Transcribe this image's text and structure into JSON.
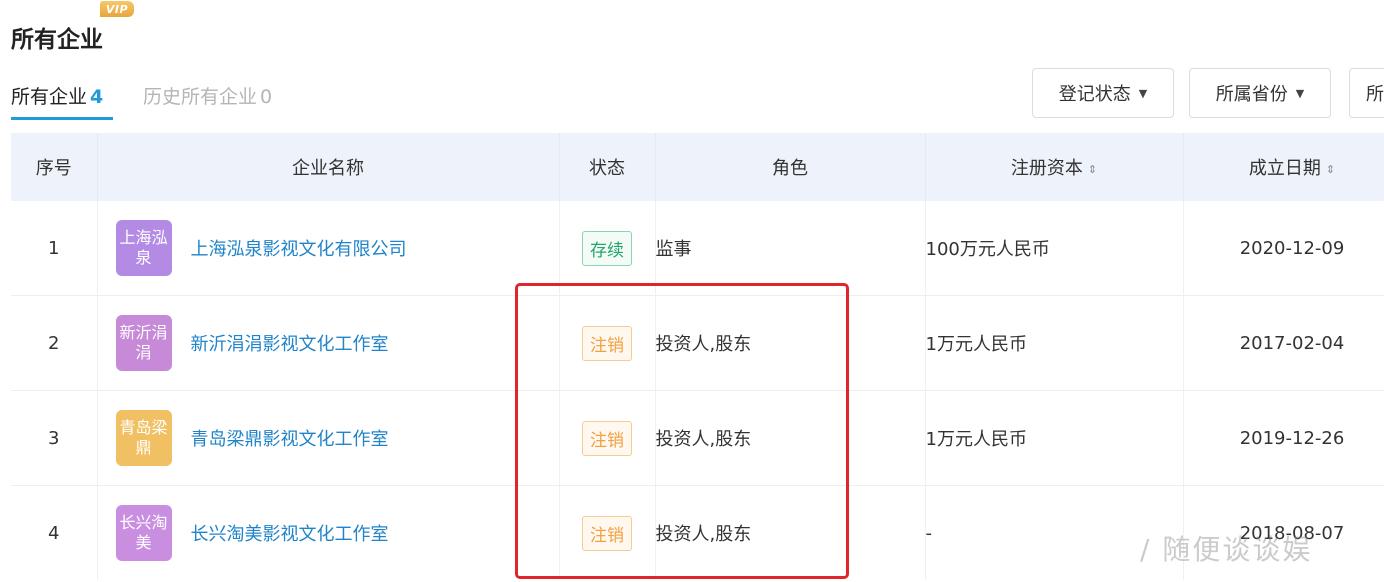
{
  "header": {
    "title": "所有企业",
    "vip_badge": "VIP"
  },
  "tabs": [
    {
      "label": "所有企业",
      "count": "4",
      "active": true
    },
    {
      "label": "历史所有企业",
      "count": "0",
      "active": false
    }
  ],
  "filters": [
    {
      "label": "登记状态"
    },
    {
      "label": "所属省份"
    },
    {
      "label": "所"
    }
  ],
  "table": {
    "columns": [
      "序号",
      "企业名称",
      "状态",
      "角色",
      "注册资本",
      "成立日期"
    ],
    "rows": [
      {
        "index": "1",
        "logo_text": "上海泓泉",
        "logo_color": "#b48be4",
        "name": "上海泓泉影视文化有限公司",
        "status": "存续",
        "status_type": "active",
        "role": "监事",
        "capital": "100万元人民币",
        "date": "2020-12-09"
      },
      {
        "index": "2",
        "logo_text": "新沂涓涓",
        "logo_color": "#c78ad8",
        "name": "新沂涓涓影视文化工作室",
        "status": "注销",
        "status_type": "cancelled",
        "role": "投资人,股东",
        "capital": "1万元人民币",
        "date": "2017-02-04"
      },
      {
        "index": "3",
        "logo_text": "青岛梁鼎",
        "logo_color": "#f0c062",
        "name": "青岛梁鼎影视文化工作室",
        "status": "注销",
        "status_type": "cancelled",
        "role": "投资人,股东",
        "capital": "1万元人民币",
        "date": "2019-12-26"
      },
      {
        "index": "4",
        "logo_text": "长兴淘美",
        "logo_color": "#c98ee0",
        "name": "长兴淘美影视文化工作室",
        "status": "注销",
        "status_type": "cancelled",
        "role": "投资人,股东",
        "capital": "-",
        "date": "2018-08-07"
      }
    ]
  },
  "watermark": "/ 随便谈谈娱",
  "colors": {
    "accent": "#1f9bd7",
    "link": "#1f84c9",
    "status_active": "#24a56a",
    "status_cancelled": "#f2a041",
    "highlight": "#e0262b",
    "header_bg": "#edf2fb"
  }
}
